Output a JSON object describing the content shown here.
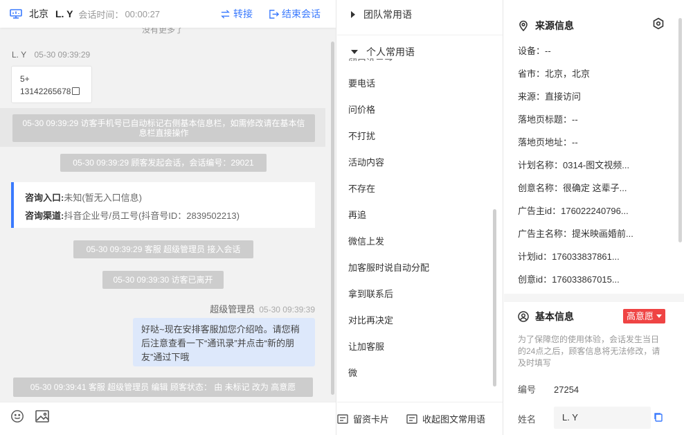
{
  "header": {
    "city": "北京",
    "visitor": "L. Y",
    "time_label": "会话时间：",
    "time_value": "00:00:27",
    "transfer_label": "转接",
    "end_label": "结束会话"
  },
  "chat": {
    "cut_text": "没有更多了",
    "visitor_name": "L. Y",
    "visitor_time": "05-30 09:39:29",
    "phone_line1": "5+",
    "phone_line2": "13142265678",
    "sys_autotag": "05-30 09:39:29 访客手机号已自动标记右侧基本信息栏，如需修改请在基本信息栏直接操作",
    "sys_start": "05-30 09:39:29 顾客发起会话，会话编号：29021",
    "entry_label": "咨询入口:",
    "entry_value": "未知(暂无入口信息)",
    "channel_label": "咨询渠道:",
    "channel_value": "抖音企业号/员工号(抖音号ID：2839502213)",
    "sys_join": "05-30 09:39:29 客服 超级管理员 接入会话",
    "sys_left": "05-30 09:39:30 访客已离开",
    "agent_name": "超级管理员",
    "agent_time": "05-30 09:39:39",
    "agent_message": "好哒~现在安排客服加您介绍哈。请您稍后注意查看一下“通讯录”并点击“新的朋友”通过下哦",
    "sys_edit": "05-30 09:39:41 客服 超级管理员 编辑 顾客状态： 由 未标记 改为 高意愿"
  },
  "phrases": {
    "team_group": "团队常用语",
    "personal_group": "个人常用语",
    "cut_item": "留口没示了",
    "items": [
      "要电话",
      "问价格",
      "不打扰",
      "活动内容",
      "不存在",
      "再追",
      "微信上发",
      "加客服时说自动分配",
      "拿到联系后",
      "对比再决定",
      "让加客服",
      "微"
    ],
    "footer_card": "留资卡片",
    "footer_collapse": "收起图文常用语"
  },
  "source": {
    "title": "来源信息",
    "fields": [
      "设备：--",
      "省市：北京，北京",
      "来源：直接访问",
      "落地页标题：--",
      "落地页地址：--",
      "计划名称：0314-图文视频...",
      "创意名称：很确定 这辈子...",
      "广告主id：176022240796...",
      "广告主名称：提米映画婚前...",
      "计划id：176033837861...",
      "创意id：176033867015..."
    ]
  },
  "basic": {
    "title": "基本信息",
    "intent": "高意愿",
    "notice": "为了保障您的使用体验，会话发生当日的24点之后，顾客信息将无法修改，请及时填写",
    "no_label": "编号",
    "no_value": "27254",
    "name_label": "姓名",
    "name_value": "L. Y"
  },
  "colors": {
    "accent": "#3a7afe",
    "intent_badge": "#ef4444",
    "agent_bubble": "#dde8fb",
    "system_message": "#cdcdcd"
  }
}
